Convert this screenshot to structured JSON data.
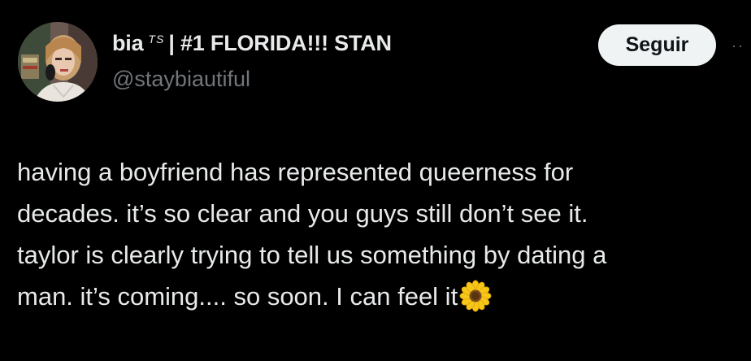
{
  "author": {
    "display_name": "bia",
    "ts_mark": "TS",
    "stan_label": "| #1 FLORIDA!!! STAN",
    "handle": "@staybiautiful"
  },
  "follow_button": {
    "label": "Seguir"
  },
  "more_button": {
    "label": "··"
  },
  "tweet": {
    "lines": [
      "having a boyfriend has represented queerness for",
      "decades. it’s so clear and you guys still don’t see it.",
      "taylor is clearly trying to tell us something by dating a",
      "man. it’s coming.... so soon. I can feel it"
    ],
    "emoji": "sunflower-emoji"
  },
  "colors": {
    "background": "#000000",
    "text_primary": "#e7e9ea",
    "text_secondary": "#71767b",
    "button_bg": "#eff3f4",
    "button_text": "#0f1419"
  }
}
